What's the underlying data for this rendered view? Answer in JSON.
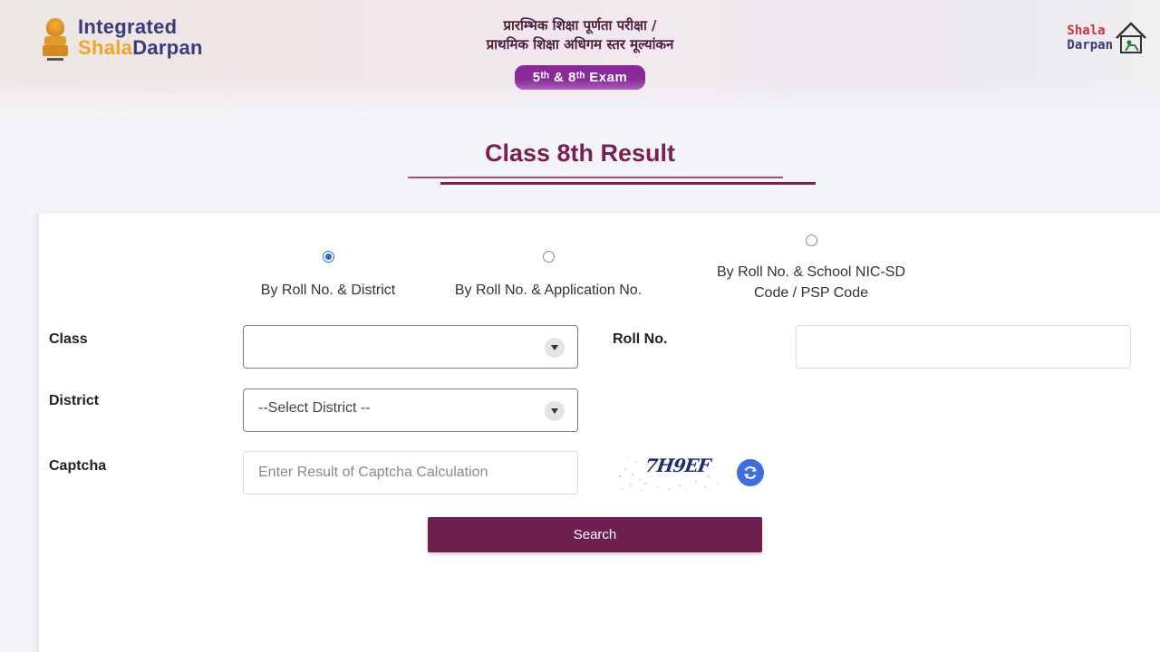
{
  "header": {
    "logo_left": {
      "line1": "Integrated",
      "line2_part1": "Shala",
      "line2_part2": "Darpan"
    },
    "hindi_line1": "प्रारम्भिक शिक्षा पूर्णता परीक्षा /",
    "hindi_line2": "प्राथमिक शिक्षा अधिगम स्तर मूल्यांकन",
    "exam_badge": "5ᵗʰ & 8ᵗʰ Exam",
    "logo_right": {
      "line1": "Shala",
      "line2": "Darpan"
    }
  },
  "page": {
    "title": "Class 8th Result"
  },
  "search_modes": [
    {
      "label": "By Roll No. & District",
      "selected": true
    },
    {
      "label": "By Roll No. & Application No.",
      "selected": false
    },
    {
      "label_line1": "By Roll No. & School NIC-SD",
      "label_line2": "Code / PSP Code",
      "selected": false
    }
  ],
  "form": {
    "class_label": "Class",
    "class_value": "",
    "roll_label": "Roll No.",
    "roll_value": "",
    "district_label": "District",
    "district_value": "--Select District --",
    "captcha_label": "Captcha",
    "captcha_placeholder": "Enter Result of Captcha Calculation",
    "captcha_code": "7H9EF",
    "search_button": "Search"
  },
  "colors": {
    "title": "#7a1f54",
    "button": "#6e1e4f",
    "exam_badge": "#8a2a9a",
    "radio_selected": "#2a6bd6",
    "refresh": "#3b6fe0"
  },
  "icons": {
    "emblem": "national-emblem-icon",
    "house": "house-icon",
    "dropdown": "chevron-down-icon",
    "refresh": "refresh-icon"
  }
}
